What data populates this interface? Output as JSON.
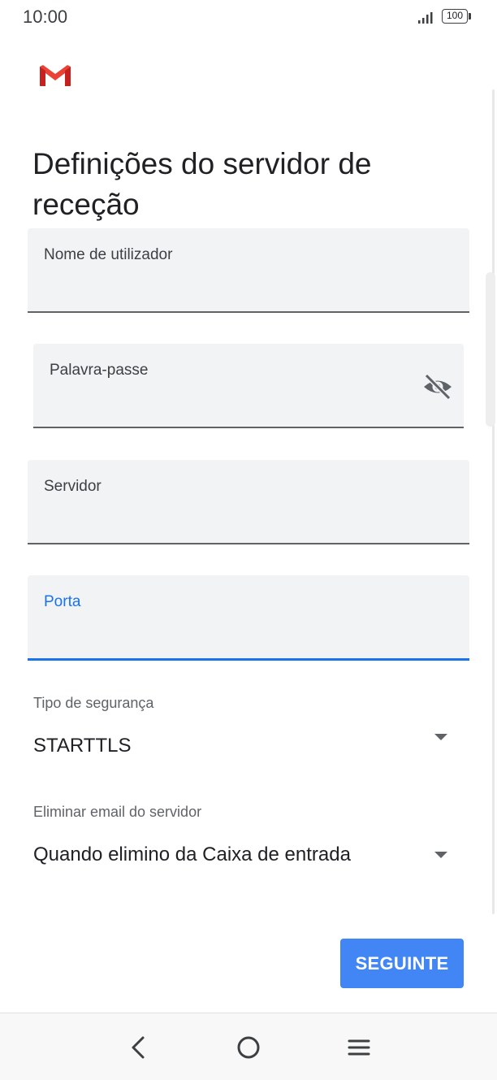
{
  "status_bar": {
    "time": "10:00",
    "battery": "100"
  },
  "app": {
    "logo_icon": "gmail-icon",
    "brand_colors": {
      "red": "#ea4335",
      "dark_red": "#c5221f"
    }
  },
  "header": {
    "title": "Definições do servidor de receção"
  },
  "form": {
    "username": {
      "label": "Nome de utilizador",
      "value": ""
    },
    "password": {
      "label": "Palavra-passe",
      "value": "",
      "toggle_icon": "eye-off-icon"
    },
    "server": {
      "label": "Servidor",
      "value": ""
    },
    "port": {
      "label": "Porta",
      "value": "",
      "focused": true
    },
    "security_type": {
      "label": "Tipo de segurança",
      "selected": "STARTTLS"
    },
    "delete_from_server": {
      "label": "Eliminar email do servidor",
      "selected": "Quando elimino da Caixa de entrada"
    }
  },
  "actions": {
    "next_label": "SEGUINTE"
  },
  "colors": {
    "accent": "#1a73e8",
    "button": "#4285f4",
    "field_bg": "#f1f3f4"
  },
  "nav": {
    "back_icon": "back-icon",
    "home_icon": "home-icon",
    "menu_icon": "menu-icon"
  }
}
